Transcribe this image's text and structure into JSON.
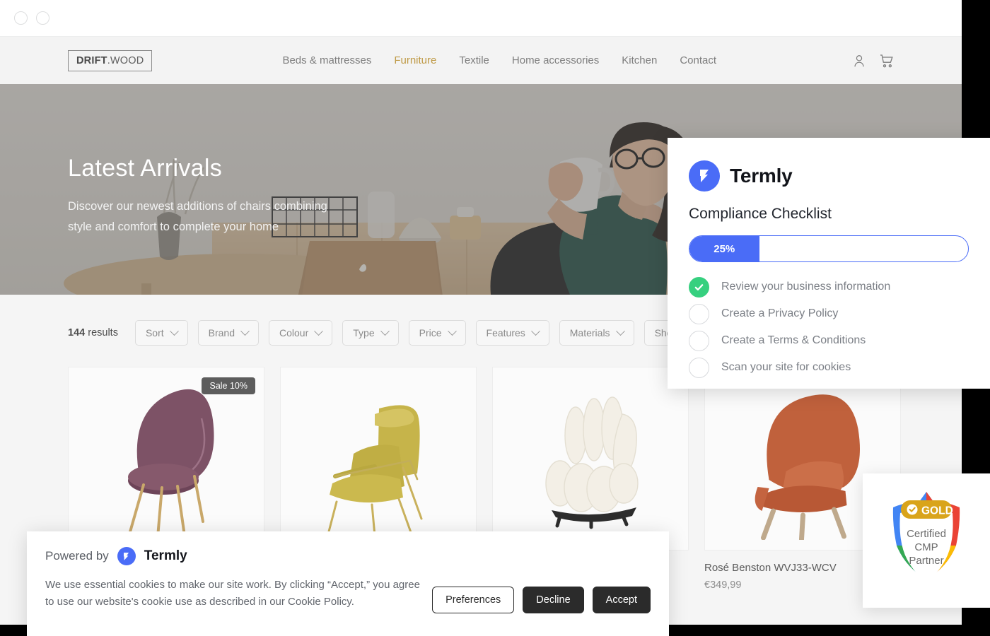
{
  "window": {
    "chrome_dots": [
      "window-dot-1",
      "window-dot-2"
    ]
  },
  "site": {
    "logo_bold": "DRIFT",
    "logo_rest": ".WOOD",
    "nav": [
      {
        "label": "Beds & mattresses",
        "active": false
      },
      {
        "label": "Furniture",
        "active": true
      },
      {
        "label": "Textile",
        "active": false
      },
      {
        "label": "Home accessories",
        "active": false
      },
      {
        "label": "Kitchen",
        "active": false
      },
      {
        "label": "Contact",
        "active": false
      }
    ],
    "icons": {
      "account": "user-icon",
      "cart": "cart-icon"
    },
    "accent_color": "#bf9a46"
  },
  "hero": {
    "title": "Latest Arrivals",
    "subtitle_line1": "Discover our newest additions of chairs combining",
    "subtitle_line2": "style and comfort to complete your home"
  },
  "shop": {
    "results_count": "144",
    "results_label": "results",
    "filters": [
      "Sort",
      "Brand",
      "Colour",
      "Type",
      "Price",
      "Features",
      "Materials",
      "Sho"
    ],
    "products": [
      {
        "name": "",
        "price": "",
        "badge": "Sale 10%",
        "color": "#7d5266",
        "kind": "shell-chair"
      },
      {
        "name": "",
        "price": "",
        "badge": "",
        "color": "#c6b44a",
        "kind": "lounge-chair"
      },
      {
        "name": "",
        "price": "",
        "badge": "",
        "color": "#f0ece2",
        "kind": "bubble-chair"
      },
      {
        "name": "Rosé Benston WVJ33-WCV",
        "price": "€349,99",
        "badge": "",
        "color": "#c0613c",
        "kind": "armchair"
      }
    ]
  },
  "checklist": {
    "brand": "Termly",
    "title": "Compliance Checklist",
    "progress_label": "25%",
    "progress_value": 25,
    "progress_color": "#4a6cf7",
    "done_color": "#36d07f",
    "items": [
      {
        "label": "Review your business information",
        "done": true
      },
      {
        "label": "Create a Privacy Policy",
        "done": false
      },
      {
        "label": "Create a Terms & Conditions",
        "done": false
      },
      {
        "label": "Scan your site for cookies",
        "done": false
      }
    ]
  },
  "cookie_banner": {
    "powered_by": "Powered by",
    "brand": "Termly",
    "message": "We use essential cookies to make our site work. By clicking “Accept,” you agree to use our website's cookie use as described in our Cookie Policy.",
    "buttons": {
      "preferences": "Preferences",
      "decline": "Decline",
      "accept": "Accept"
    }
  },
  "gold_badge": {
    "ribbon": "GOLD",
    "line1": "Certified",
    "line2": "CMP",
    "line3": "Partner",
    "colors": {
      "blue": "#4285f4",
      "red": "#ea4335",
      "yellow": "#fbbc05",
      "green": "#34a853",
      "gold": "#d9a41b"
    }
  }
}
